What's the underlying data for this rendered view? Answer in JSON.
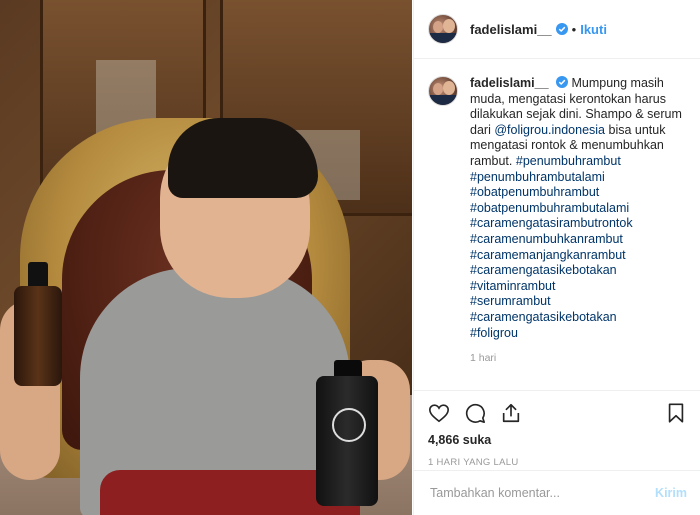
{
  "post": {
    "username": "fadelislami__",
    "follow_label": "Ikuti",
    "separator": "•",
    "caption": {
      "username": "fadelislami__",
      "text_before_mention": "Mumpung masih muda, mengatasi kerontokan harus dilakukan sejak dini. Shampo & serum dari ",
      "mention": "@foligrou.indonesia",
      "text_after_mention": " bisa untuk mengatasi rontok & menumbuhkan rambut.",
      "first_hashtag": "#penumbuhrambut",
      "hashtags": [
        "#penumbuhrambutalami",
        "#obatpenumbuhrambut",
        "#obatpenumbuhrambutalami",
        "#caramengatasirambutrontok",
        "#caramenumbuhkanrambut",
        "#caramemanjangkanrambut",
        "#caramengatasikebotakan",
        "#vitaminrambut",
        "#serumrambut",
        "#caramengatasikebotakan",
        "#foligrou"
      ],
      "time": "1 hari"
    },
    "likes": "4,866 suka",
    "posted_ago": "1 HARI YANG LALU",
    "comment_placeholder": "Tambahkan komentar...",
    "post_button": "Kirim"
  },
  "colors": {
    "link": "#003569",
    "follow": "#3897f0",
    "verified": "#3897f0",
    "post_button_disabled": "#b2dffc",
    "muted": "#999999"
  },
  "icons": [
    "heart-icon",
    "comment-icon",
    "share-icon",
    "bookmark-icon",
    "verified-badge-icon"
  ]
}
